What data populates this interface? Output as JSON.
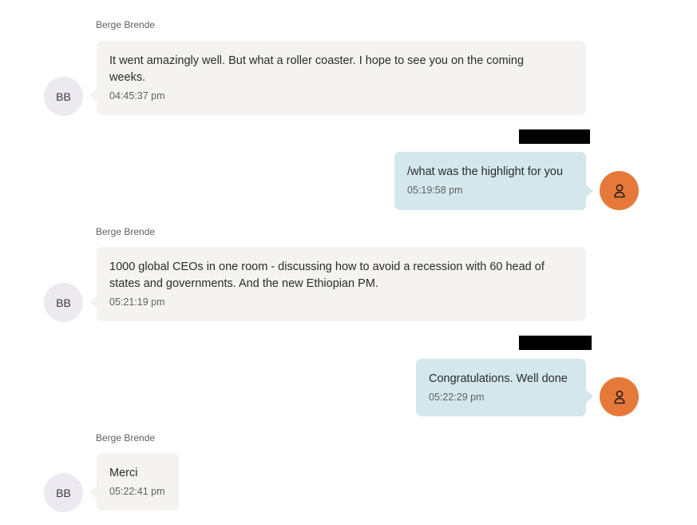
{
  "messages": [
    {
      "direction": "incoming",
      "sender": "Berge Brende",
      "avatar_initials": "BB",
      "text": "It went amazingly well. But what a roller coaster. I hope to see you on the coming weeks.",
      "time": "04:45:37 pm"
    },
    {
      "direction": "outgoing",
      "sender_redacted": true,
      "avatar_icon": "person-icon",
      "text": "/what was the highlight for you",
      "time": "05:19:58 pm"
    },
    {
      "direction": "incoming",
      "sender": "Berge Brende",
      "avatar_initials": "BB",
      "text": "1000 global CEOs in one room - discussing how to avoid a recession with 60 head of states and governments. And the new Ethiopian PM.",
      "time": "05:21:19 pm"
    },
    {
      "direction": "outgoing",
      "sender_redacted": true,
      "avatar_icon": "person-icon",
      "text": "Congratulations. Well done",
      "time": "05:22:29 pm"
    },
    {
      "direction": "incoming",
      "sender": "Berge Brende",
      "avatar_initials": "BB",
      "text": "Merci",
      "time": "05:22:41 pm"
    }
  ],
  "colors": {
    "incoming_bubble": "#f4f3f1",
    "outgoing_bubble": "#d4e7ed",
    "incoming_avatar": "#eceaf0",
    "outgoing_avatar": "#e6793a",
    "redaction": "#000000"
  }
}
